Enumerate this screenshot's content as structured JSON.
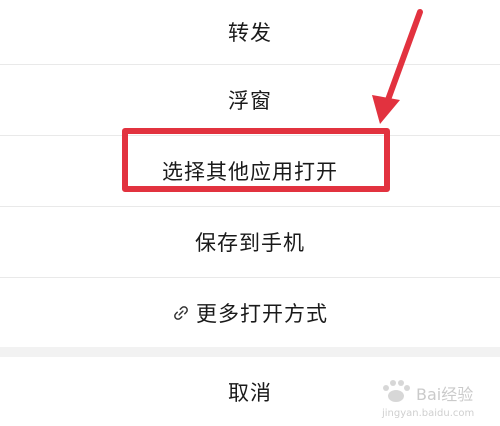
{
  "menu": {
    "forward": "转发",
    "float_window": "浮窗",
    "open_with_other_app": "选择其他应用打开",
    "save_to_phone": "保存到手机",
    "more_open_methods": "更多打开方式",
    "cancel": "取消"
  },
  "annotation": {
    "highlight_color": "#e2323f"
  },
  "icons": {
    "more_open_methods": "link-icon"
  },
  "watermark": {
    "text_main": "Bai经验",
    "text_sub": "jingyan.baidu.com"
  }
}
